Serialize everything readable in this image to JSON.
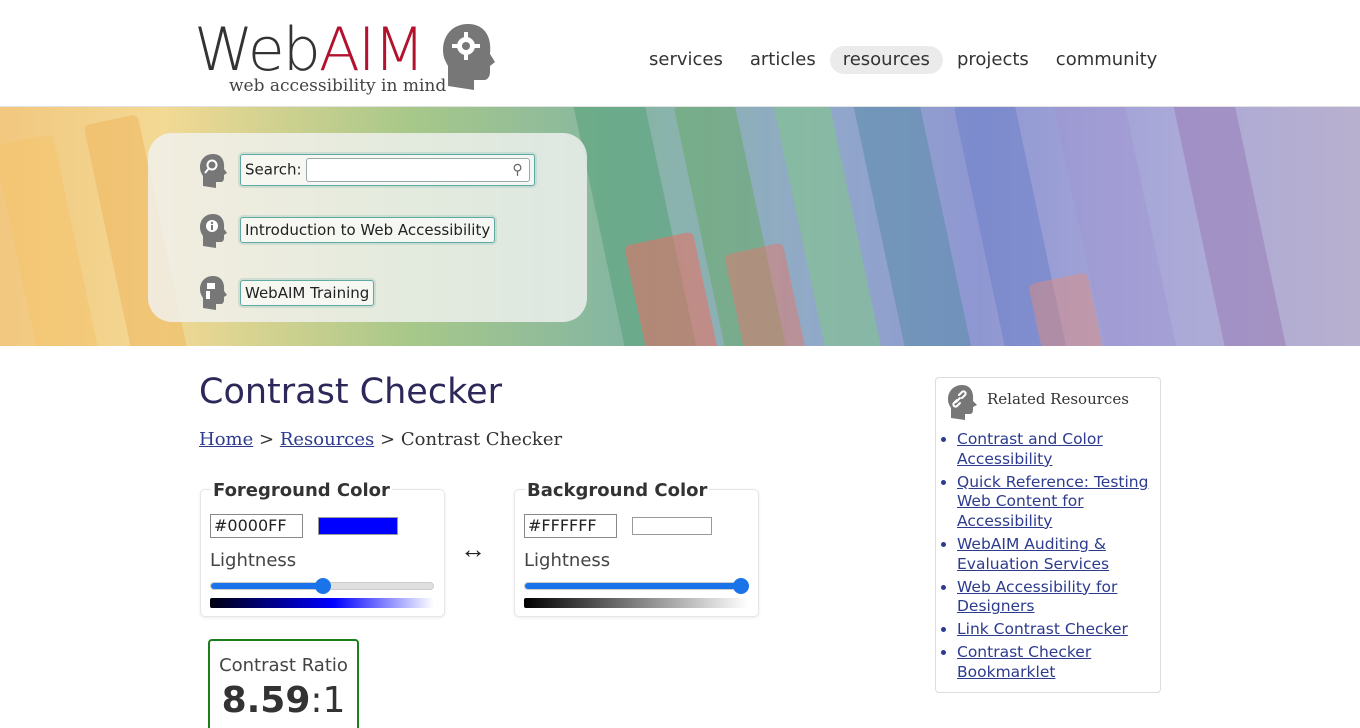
{
  "logo": {
    "text_web": "Web",
    "text_aim": "AIM",
    "tagline": "web accessibility in mind"
  },
  "nav": [
    {
      "label": "services",
      "active": false
    },
    {
      "label": "articles",
      "active": false
    },
    {
      "label": "resources",
      "active": true
    },
    {
      "label": "projects",
      "active": false
    },
    {
      "label": "community",
      "active": false
    }
  ],
  "quick": {
    "search_label": "Search:",
    "search_value": "",
    "intro_label": "Introduction to Web Accessibility",
    "training_label": "WebAIM Training"
  },
  "page": {
    "title": "Contrast Checker"
  },
  "breadcrumb": {
    "home": "Home",
    "sep1": ">",
    "resources": "Resources",
    "sep2": ">",
    "current": "Contrast Checker"
  },
  "foreground": {
    "title": "Foreground Color",
    "hex": "#0000FF",
    "color": "#0000FF",
    "lightness_label": "Lightness",
    "lightness": 0.5
  },
  "background": {
    "title": "Background Color",
    "hex": "#FFFFFF",
    "color": "#FFFFFF",
    "lightness_label": "Lightness",
    "lightness": 1.0
  },
  "swap_symbol": "↔",
  "contrast": {
    "label": "Contrast Ratio",
    "value": "8.59",
    "suffix": ":1"
  },
  "related": {
    "title": "Related Resources",
    "items": [
      "Contrast and Color Accessibility",
      "Quick Reference: Testing Web Content for Accessibility",
      "WebAIM Auditing & Evaluation Services",
      "Web Accessibility for Designers",
      "Link Contrast Checker",
      "Contrast Checker Bookmarklet"
    ]
  },
  "colors": {
    "accent": "#1a73e8",
    "brand_red": "#b3122e",
    "link": "#2d3b8e",
    "pass_green": "#1a7f1a",
    "title": "#2c2859"
  }
}
